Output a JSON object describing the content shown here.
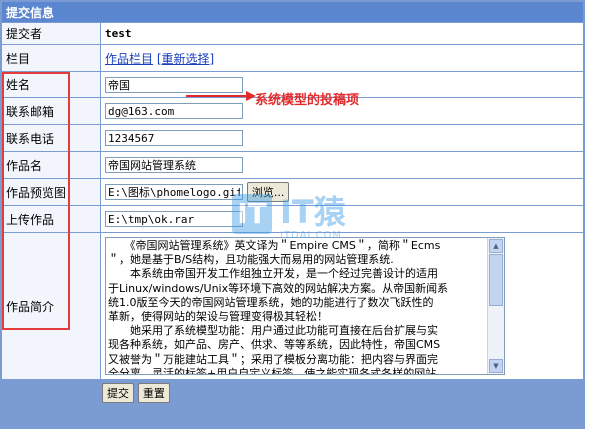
{
  "section_title": "提交信息",
  "fields": [
    {
      "label": "提交者",
      "value": "test"
    },
    {
      "label": "栏目",
      "link1": "作品栏目",
      "link2": "[重新选择]"
    }
  ],
  "model_fields": [
    {
      "label": "姓名",
      "value": "帝国"
    },
    {
      "label": "联系邮箱",
      "value": "dg@163.com"
    },
    {
      "label": "联系电话",
      "value": "1234567"
    },
    {
      "label": "作品名",
      "value": "帝国网站管理系统"
    },
    {
      "label": "作品预览图",
      "value": "E:\\图标\\phomelogo.gif",
      "browse": "浏览..."
    },
    {
      "label": "上传作品",
      "value": "E:\\tmp\\ok.rar"
    }
  ],
  "intro": {
    "label": "作品简介",
    "lines": [
      "　　《帝国网站管理系统》英文译为＂Empire CMS＂，简称＂Ecms",
      "＂，她是基于B/S结构，且功能强大而易用的网站管理系统.",
      "　　本系统由帝国开发工作组独立开发，是一个经过完善设计的适用",
      "于Linux/windows/Unix等环境下高效的网站解决方案。从帝国新闻系",
      "统1.0版至今天的帝国网站管理系统，她的功能进行了数次飞跃性的",
      "革新，使得网站的架设与管理变得极其轻松！",
      "　　她采用了系统模型功能：用户通过此功能可直接在后台扩展与实",
      "现各种系统，如产品、房产、供求、等等系统，因此特性，帝国CMS",
      "又被誉为＂万能建站工具＂；采用了模板分离功能：把内容与界面完",
      "全分离，灵活的标签+用户自定义标签，使之能实现各式各样的网站"
    ]
  },
  "buttons": {
    "submit": "提交",
    "reset": "重置"
  },
  "annotation": "系统模型的投稿项",
  "watermark": {
    "logo_letter": "IT",
    "name": "IT猿",
    "domain": "ITDAI.COM"
  },
  "colors": {
    "header": "#5b86d0",
    "label_bg": "#f2f6fc",
    "border": "#7b9cd2",
    "highlight": "#e43c3c"
  }
}
